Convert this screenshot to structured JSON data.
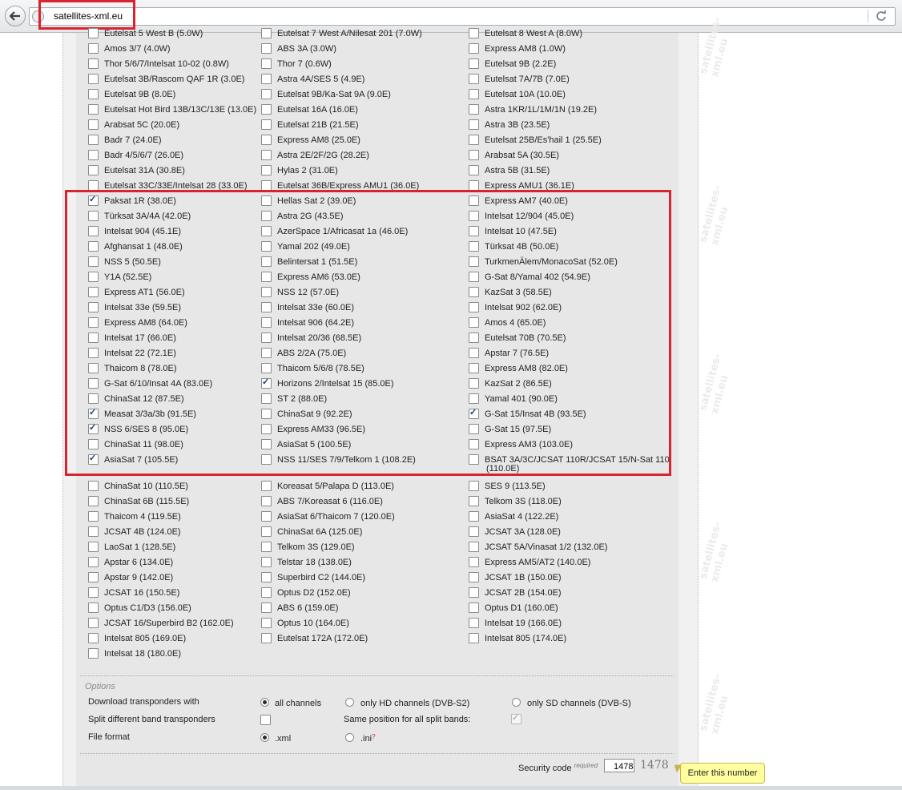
{
  "browser": {
    "url": "satellites-xml.eu"
  },
  "watermark": "satellites-xml.eu",
  "columns": [
    [
      {
        "label": "Eutelsat 5 West B (5.0W)",
        "checked": false
      },
      {
        "label": "Amos 3/7 (4.0W)",
        "checked": false
      },
      {
        "label": "Thor 5/6/7/Intelsat 10-02 (0.8W)",
        "checked": false
      },
      {
        "label": "Eutelsat 3B/Rascom QAF 1R (3.0E)",
        "checked": false
      },
      {
        "label": "Eutelsat 9B (8.0E)",
        "checked": false
      },
      {
        "label": "Eutelsat Hot Bird 13B/13C/13E (13.0E)",
        "checked": false
      },
      {
        "label": "Arabsat 5C (20.0E)",
        "checked": false
      },
      {
        "label": "Badr 7 (24.0E)",
        "checked": false
      },
      {
        "label": "Badr 4/5/6/7 (26.0E)",
        "checked": false
      },
      {
        "label": "Eutelsat 31A (30.8E)",
        "checked": false
      },
      {
        "label": "Eutelsat 33C/33E/Intelsat 28 (33.0E)",
        "checked": false
      },
      {
        "label": "Paksat 1R (38.0E)",
        "checked": true
      },
      {
        "label": "Türksat 3A/4A (42.0E)",
        "checked": false
      },
      {
        "label": "Intelsat 904 (45.1E)",
        "checked": false
      },
      {
        "label": "Afghansat 1 (48.0E)",
        "checked": false
      },
      {
        "label": "NSS 5 (50.5E)",
        "checked": false
      },
      {
        "label": "Y1A (52.5E)",
        "checked": false
      },
      {
        "label": "Express AT1 (56.0E)",
        "checked": false
      },
      {
        "label": "Intelsat 33e (59.5E)",
        "checked": false
      },
      {
        "label": "Express AM8 (64.0E)",
        "checked": false
      },
      {
        "label": "Intelsat 17 (66.0E)",
        "checked": false
      },
      {
        "label": "Intelsat 22 (72.1E)",
        "checked": false
      },
      {
        "label": "Thaicom 8 (78.0E)",
        "checked": false
      },
      {
        "label": "G-Sat 6/10/Insat 4A (83.0E)",
        "checked": false
      },
      {
        "label": "ChinaSat 12 (87.5E)",
        "checked": false
      },
      {
        "label": "Measat 3/3a/3b (91.5E)",
        "checked": true
      },
      {
        "label": "NSS 6/SES 8 (95.0E)",
        "checked": true
      },
      {
        "label": "ChinaSat 11 (98.0E)",
        "checked": false
      },
      {
        "label": "AsiaSat 7 (105.5E)",
        "checked": true
      },
      {
        "label": "ChinaSat 10 (110.5E)",
        "checked": false
      },
      {
        "label": "ChinaSat 6B (115.5E)",
        "checked": false
      },
      {
        "label": "Thaicom 4 (119.5E)",
        "checked": false
      },
      {
        "label": "JCSAT 4B (124.0E)",
        "checked": false
      },
      {
        "label": "LaoSat 1 (128.5E)",
        "checked": false
      },
      {
        "label": "Apstar 6 (134.0E)",
        "checked": false
      },
      {
        "label": "Apstar 9 (142.0E)",
        "checked": false
      },
      {
        "label": "JCSAT 16 (150.5E)",
        "checked": false
      },
      {
        "label": "Optus C1/D3 (156.0E)",
        "checked": false
      },
      {
        "label": "JCSAT 16/Superbird B2 (162.0E)",
        "checked": false
      },
      {
        "label": "Intelsat 805 (169.0E)",
        "checked": false
      },
      {
        "label": "Intelsat 18 (180.0E)",
        "checked": false
      }
    ],
    [
      {
        "label": "Eutelsat 7 West A/Nilesat 201 (7.0W)",
        "checked": false
      },
      {
        "label": "ABS 3A (3.0W)",
        "checked": false
      },
      {
        "label": "Thor 7 (0.6W)",
        "checked": false
      },
      {
        "label": "Astra 4A/SES 5 (4.9E)",
        "checked": false
      },
      {
        "label": "Eutelsat 9B/Ka-Sat 9A (9.0E)",
        "checked": false
      },
      {
        "label": "Eutelsat 16A (16.0E)",
        "checked": false
      },
      {
        "label": "Eutelsat 21B (21.5E)",
        "checked": false
      },
      {
        "label": "Express AM8 (25.0E)",
        "checked": false
      },
      {
        "label": "Astra 2E/2F/2G (28.2E)",
        "checked": false
      },
      {
        "label": "Hylas 2 (31.0E)",
        "checked": false
      },
      {
        "label": "Eutelsat 36B/Express AMU1 (36.0E)",
        "checked": false
      },
      {
        "label": "Hellas Sat 2 (39.0E)",
        "checked": false
      },
      {
        "label": "Astra 2G (43.5E)",
        "checked": false
      },
      {
        "label": "AzerSpace 1/Africasat 1a (46.0E)",
        "checked": false
      },
      {
        "label": "Yamal 202 (49.0E)",
        "checked": false
      },
      {
        "label": "Belintersat 1 (51.5E)",
        "checked": false
      },
      {
        "label": "Express AM6 (53.0E)",
        "checked": false
      },
      {
        "label": "NSS 12 (57.0E)",
        "checked": false
      },
      {
        "label": "Intelsat 33e (60.0E)",
        "checked": false
      },
      {
        "label": "Intelsat 906 (64.2E)",
        "checked": false
      },
      {
        "label": "Intelsat 20/36 (68.5E)",
        "checked": false
      },
      {
        "label": "ABS 2/2A (75.0E)",
        "checked": false
      },
      {
        "label": "Thaicom 5/6/8 (78.5E)",
        "checked": false
      },
      {
        "label": "Horizons 2/Intelsat 15 (85.0E)",
        "checked": true
      },
      {
        "label": "ST 2 (88.0E)",
        "checked": false
      },
      {
        "label": "ChinaSat 9 (92.2E)",
        "checked": false
      },
      {
        "label": "Express AM33 (96.5E)",
        "checked": false
      },
      {
        "label": "AsiaSat 5 (100.5E)",
        "checked": false
      },
      {
        "label": "NSS 11/SES 7/9/Telkom 1 (108.2E)",
        "checked": false
      },
      {
        "label": "Koreasat 5/Palapa D (113.0E)",
        "checked": false
      },
      {
        "label": "ABS 7/Koreasat 6 (116.0E)",
        "checked": false
      },
      {
        "label": "AsiaSat 6/Thaicom 7 (120.0E)",
        "checked": false
      },
      {
        "label": "ChinaSat 6A (125.0E)",
        "checked": false
      },
      {
        "label": "Telkom 3S (129.0E)",
        "checked": false
      },
      {
        "label": "Telstar 18 (138.0E)",
        "checked": false
      },
      {
        "label": "Superbird C2 (144.0E)",
        "checked": false
      },
      {
        "label": "Optus D2 (152.0E)",
        "checked": false
      },
      {
        "label": "ABS 6 (159.0E)",
        "checked": false
      },
      {
        "label": "Optus 10 (164.0E)",
        "checked": false
      },
      {
        "label": "Eutelsat 172A (172.0E)",
        "checked": false
      }
    ],
    [
      {
        "label": "Eutelsat 8 West A (8.0W)",
        "checked": false
      },
      {
        "label": "Express AM8 (1.0W)",
        "checked": false
      },
      {
        "label": "Eutelsat 9B (2.2E)",
        "checked": false
      },
      {
        "label": "Eutelsat 7A/7B (7.0E)",
        "checked": false
      },
      {
        "label": "Eutelsat 10A (10.0E)",
        "checked": false
      },
      {
        "label": "Astra 1KR/1L/1M/1N (19.2E)",
        "checked": false
      },
      {
        "label": "Astra 3B (23.5E)",
        "checked": false
      },
      {
        "label": "Eutelsat 25B/Es'hail 1 (25.5E)",
        "checked": false
      },
      {
        "label": "Arabsat 5A (30.5E)",
        "checked": false
      },
      {
        "label": "Astra 5B (31.5E)",
        "checked": false
      },
      {
        "label": "Express AMU1 (36.1E)",
        "checked": false
      },
      {
        "label": "Express AM7 (40.0E)",
        "checked": false
      },
      {
        "label": "Intelsat 12/904 (45.0E)",
        "checked": false
      },
      {
        "label": "Intelsat 10 (47.5E)",
        "checked": false
      },
      {
        "label": "Türksat 4B (50.0E)",
        "checked": false
      },
      {
        "label": "TurkmenÄlem/MonacoSat (52.0E)",
        "checked": false
      },
      {
        "label": "G-Sat 8/Yamal 402 (54.9E)",
        "checked": false
      },
      {
        "label": "KazSat 3 (58.5E)",
        "checked": false
      },
      {
        "label": "Intelsat 902 (62.0E)",
        "checked": false
      },
      {
        "label": "Amos 4 (65.0E)",
        "checked": false
      },
      {
        "label": "Eutelsat 70B (70.5E)",
        "checked": false
      },
      {
        "label": "Apstar 7 (76.5E)",
        "checked": false
      },
      {
        "label": "Express AM8 (82.0E)",
        "checked": false
      },
      {
        "label": "KazSat 2 (86.5E)",
        "checked": false
      },
      {
        "label": "Yamal 401 (90.0E)",
        "checked": false
      },
      {
        "label": "G-Sat 15/Insat 4B (93.5E)",
        "checked": true
      },
      {
        "label": "G-Sat 15 (97.5E)",
        "checked": false
      },
      {
        "label": "Express AM3 (103.0E)",
        "checked": false
      },
      {
        "label": "BSAT 3A/3C/JCSAT 110R/JCSAT 15/N-Sat 110",
        "checked": false,
        "wrap": "(110.0E)"
      },
      {
        "label": "SES 9 (113.5E)",
        "checked": false
      },
      {
        "label": "Telkom 3S (118.0E)",
        "checked": false
      },
      {
        "label": "AsiaSat 4 (122.2E)",
        "checked": false
      },
      {
        "label": "JCSAT 3A (128.0E)",
        "checked": false
      },
      {
        "label": "JCSAT 5A/Vinasat 1/2 (132.0E)",
        "checked": false
      },
      {
        "label": "Express AM5/AT2 (140.0E)",
        "checked": false
      },
      {
        "label": "JCSAT 1B (150.0E)",
        "checked": false
      },
      {
        "label": "JCSAT 2B (154.0E)",
        "checked": false
      },
      {
        "label": "Optus D1 (160.0E)",
        "checked": false
      },
      {
        "label": "Intelsat 19 (166.0E)",
        "checked": false
      },
      {
        "label": "Intelsat 805 (174.0E)",
        "checked": false
      }
    ]
  ],
  "options": {
    "legend": "Options",
    "download_label": "Download transponders with",
    "download_choices": [
      {
        "label": "all channels",
        "selected": true
      },
      {
        "label": "only HD channels (DVB-S2)",
        "selected": false
      },
      {
        "label": "only SD channels (DVB-S)",
        "selected": false
      }
    ],
    "split_label": "Split different band transponders",
    "split_checked": false,
    "same_position_label": "Same position for all split bands:",
    "same_position_checked": true,
    "format_label": "File format",
    "format_choices": [
      {
        "label": ".xml",
        "selected": true
      },
      {
        "label": ".ini",
        "selected": false,
        "help": "?"
      }
    ]
  },
  "security": {
    "label": "Security code",
    "required": "required",
    "value": "1478",
    "captcha": "1478",
    "tooltip": "Enter this number"
  }
}
